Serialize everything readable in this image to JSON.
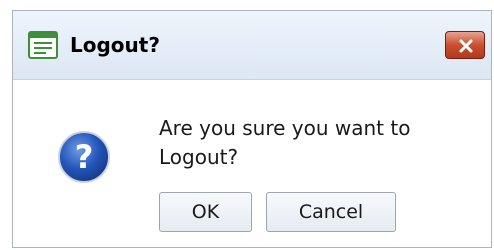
{
  "window": {
    "title": "Logout?",
    "title_icon": "window-form-icon",
    "close_icon": "close-icon"
  },
  "dialog": {
    "message": "Are you sure you want to Logout?",
    "icon": "question-icon"
  },
  "buttons": {
    "ok_label": "OK",
    "cancel_label": "Cancel"
  },
  "colors": {
    "title_bar": "#dce7f4",
    "close_button": "#c8502f",
    "question_icon": "#1f4fa8",
    "title_icon": "#3f8f3a"
  }
}
